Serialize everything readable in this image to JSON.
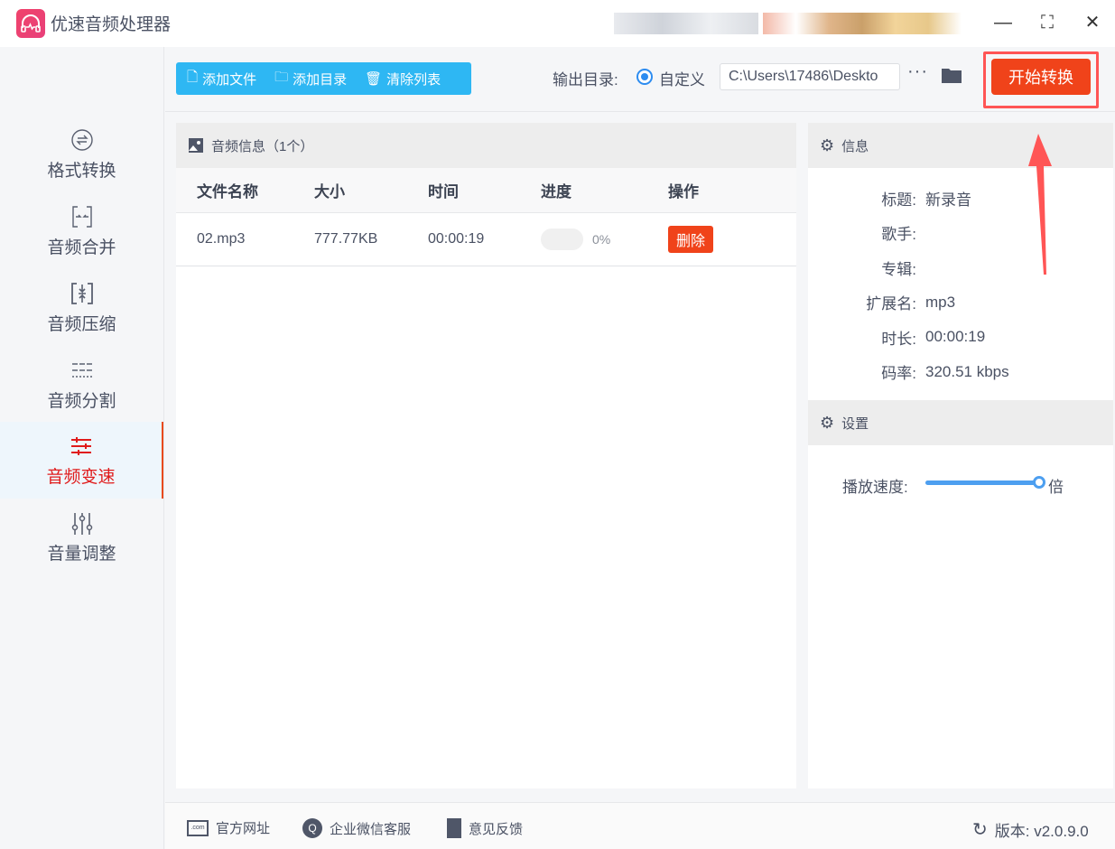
{
  "app": {
    "title": "优速音频处理器"
  },
  "window": {
    "minimize_icon": "minimize-icon",
    "maximize_icon": "maximize-icon",
    "close_icon": "close-icon"
  },
  "sidebar": {
    "items": [
      {
        "label": "格式转换",
        "icon": "format-convert-icon"
      },
      {
        "label": "音频合并",
        "icon": "merge-icon"
      },
      {
        "label": "音频压缩",
        "icon": "compress-icon"
      },
      {
        "label": "音频分割",
        "icon": "split-icon"
      },
      {
        "label": "音频变速",
        "icon": "speed-icon",
        "active": true
      },
      {
        "label": "音量调整",
        "icon": "volume-icon"
      }
    ]
  },
  "toolbar": {
    "add_file": "添加文件",
    "add_dir": "添加目录",
    "clear_list": "清除列表",
    "output_label": "输出目录:",
    "radio_label": "自定义",
    "output_path": "C:\\Users\\17486\\Deskto",
    "more": "···",
    "start": "开始转换"
  },
  "filelist": {
    "header": "音频信息（1个）",
    "columns": [
      "文件名称",
      "大小",
      "时间",
      "进度",
      "操作"
    ],
    "rows": [
      {
        "name": "02.mp3",
        "size": "777.77KB",
        "time": "00:00:19",
        "progress": "0%",
        "action": "删除"
      }
    ]
  },
  "info": {
    "header": "信息",
    "fields": [
      {
        "k": "标题:",
        "v": "新录音"
      },
      {
        "k": "歌手:",
        "v": ""
      },
      {
        "k": "专辑:",
        "v": ""
      },
      {
        "k": "扩展名:",
        "v": "mp3"
      },
      {
        "k": "时长:",
        "v": "00:00:19"
      },
      {
        "k": "码率:",
        "v": "320.51 kbps"
      }
    ]
  },
  "settings": {
    "header": "设置",
    "speed_label": "播放速度:",
    "speed_unit": "倍",
    "speed_slider_fraction": 1.0
  },
  "footer": {
    "website": "官方网址",
    "wechat": "企业微信客服",
    "feedback": "意见反馈",
    "version": "版本: v2.0.9.0"
  },
  "colors": {
    "accent": "#2eb7f3",
    "danger": "#f0431a",
    "active_nav": "#e01b1b",
    "slider": "#4d9ff0"
  }
}
